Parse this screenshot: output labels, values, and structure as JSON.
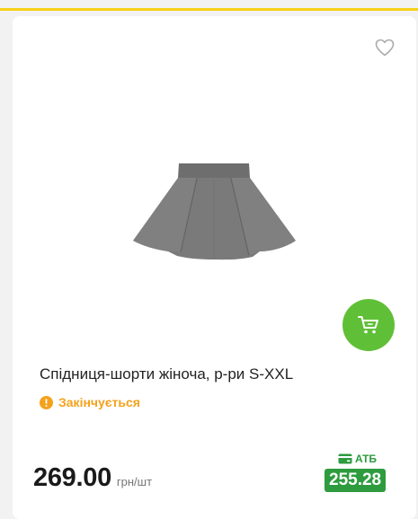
{
  "colors": {
    "accent_yellow": "#f7d117",
    "green": "#5fc038",
    "dark_green": "#2e9b3e",
    "warning_orange": "#f4a21c",
    "text_dark": "#222222",
    "text_muted": "#777777"
  },
  "product": {
    "title": "Спідниця-шорти жіноча, р-ри S-XXL",
    "status": "Закінчується",
    "price": "269.00",
    "price_unit": "грн/шт",
    "card_label": "АТБ",
    "card_price": "255.28"
  },
  "icons": {
    "favorite": "heart-icon",
    "cart": "cart-icon",
    "status": "warning-icon",
    "card": "card-icon"
  }
}
